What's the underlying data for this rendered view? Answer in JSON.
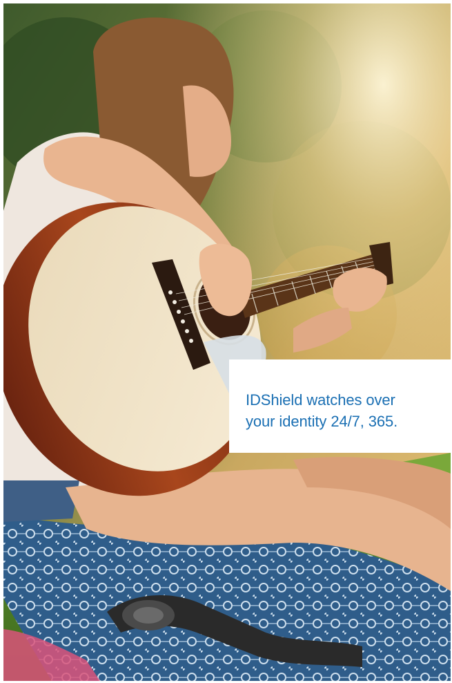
{
  "caption": {
    "line1": "IDShield watches over",
    "line2": "your identity 24/7, 365."
  },
  "colors": {
    "caption_text": "#1a6fb3",
    "caption_box": "#ffffff"
  },
  "image": {
    "subject": "photo-of-woman-playing-acoustic-guitar-outdoors"
  }
}
